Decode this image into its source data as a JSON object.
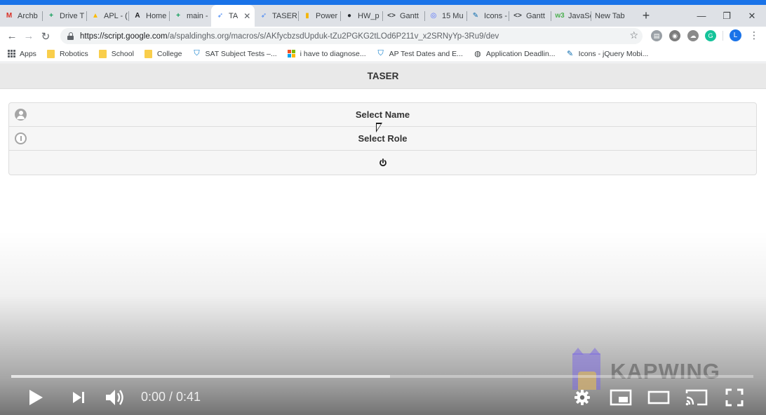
{
  "browser": {
    "accent_color": "#1a73e8",
    "tabs": [
      {
        "label": "Archb",
        "favicon": "gmail-icon",
        "color": "#d93025",
        "glyph": "M"
      },
      {
        "label": "Drive T",
        "favicon": "sheets-icon",
        "color": "#0f9d58",
        "glyph": "+"
      },
      {
        "label": "APL - (",
        "favicon": "drive-icon",
        "color": "#fbbc04",
        "glyph": "▲"
      },
      {
        "label": "Home",
        "favicon": "app-a-icon",
        "color": "#202124",
        "glyph": "A"
      },
      {
        "label": "main -",
        "favicon": "sheets-icon",
        "color": "#0f9d58",
        "glyph": "+"
      },
      {
        "label": "TA",
        "favicon": "apps-script-icon",
        "color": "#4285f4",
        "glyph": "➶",
        "active": true
      },
      {
        "label": "TASER",
        "favicon": "apps-script-icon",
        "color": "#4285f4",
        "glyph": "➶"
      },
      {
        "label": "Power",
        "favicon": "slides-icon",
        "color": "#f4b400",
        "glyph": "▮"
      },
      {
        "label": "HW_p",
        "favicon": "github-icon",
        "color": "#24292e",
        "glyph": "●"
      },
      {
        "label": "Gantt",
        "favicon": "code-icon",
        "color": "#3c4043",
        "glyph": "<>"
      },
      {
        "label": "15 Mu",
        "favicon": "goggles-icon",
        "color": "#4d6bfe",
        "glyph": "◎"
      },
      {
        "label": "Icons -",
        "favicon": "jquery-icon",
        "color": "#0769ad",
        "glyph": "✎"
      },
      {
        "label": "Gantt",
        "favicon": "code-icon",
        "color": "#3c4043",
        "glyph": "<>"
      },
      {
        "label": "JavaSc",
        "favicon": "w3-icon",
        "color": "#4caf50",
        "glyph": "w3"
      },
      {
        "label": "New Tab",
        "favicon": "",
        "color": "",
        "glyph": ""
      }
    ],
    "new_tab_glyph": "+",
    "window_controls": {
      "minimize": "—",
      "restore": "❐",
      "close": "✕"
    },
    "url_host": "https://script.google.com",
    "url_path": "/a/spaldinghs.org/macros/s/AKfycbzsdUpduk-tZu2PGKG2tLOd6P211v_x2SRNyYp-3Ru9/dev",
    "profile_initial": "L",
    "bookmarks": [
      {
        "label": "Apps",
        "icon": "apps-grid-icon"
      },
      {
        "label": "Robotics",
        "icon": "folder-icon"
      },
      {
        "label": "School",
        "icon": "folder-icon"
      },
      {
        "label": "College",
        "icon": "folder-icon"
      },
      {
        "label": "SAT Subject Tests –...",
        "icon": "collegeboard-icon"
      },
      {
        "label": "i have to diagnose...",
        "icon": "microsoft-icon"
      },
      {
        "label": "AP Test Dates and E...",
        "icon": "collegeboard-icon"
      },
      {
        "label": "Application Deadlin...",
        "icon": "globe-icon"
      },
      {
        "label": "Icons - jQuery Mobi...",
        "icon": "jquery-icon"
      }
    ]
  },
  "app": {
    "header_title": "TASER",
    "list": [
      {
        "label": "Select Name",
        "icon": "user-icon"
      },
      {
        "label": "Select Role",
        "icon": "info-icon"
      },
      {
        "label": "",
        "icon": "power-icon"
      }
    ]
  },
  "player": {
    "watermark": "KAPWING",
    "time_display": "0:00 / 0:41",
    "loaded_fraction": 0.51,
    "played_fraction": 0.0
  }
}
